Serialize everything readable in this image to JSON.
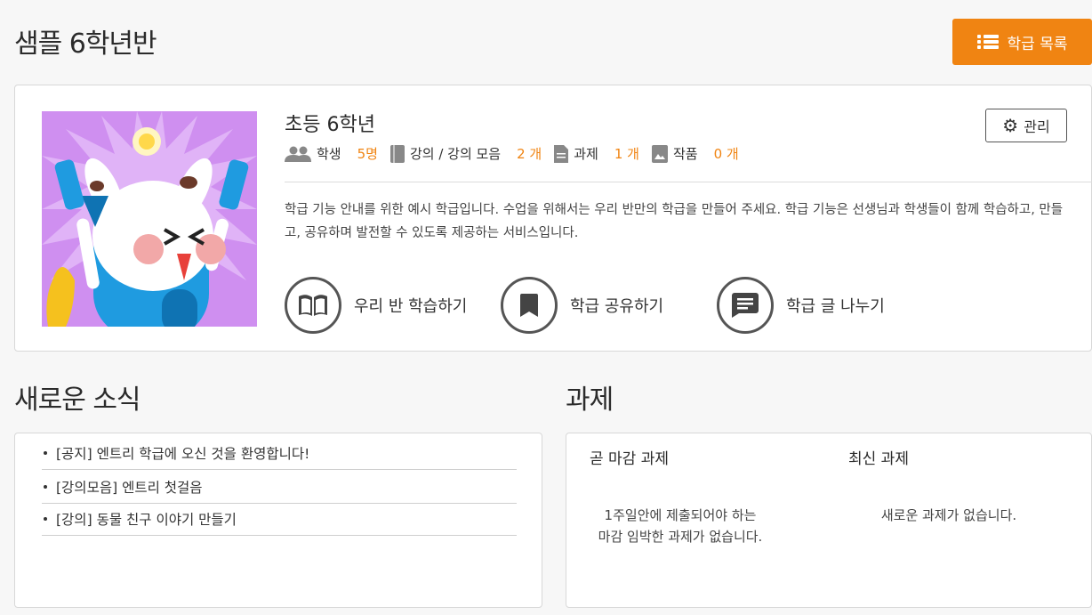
{
  "page": {
    "title": "샘플 6학년반"
  },
  "header": {
    "list_button_label": "학급 목록"
  },
  "class_card": {
    "name": "초등 6학년",
    "manage_label": "관리",
    "stats": [
      {
        "icon": "people-icon",
        "label": "학생",
        "count": "5명"
      },
      {
        "icon": "book-icon",
        "label": "강의 / 강의 모음",
        "count": "2 개"
      },
      {
        "icon": "document-icon",
        "label": "과제",
        "count": "1 개"
      },
      {
        "icon": "image-icon",
        "label": "작품",
        "count": "0 개"
      }
    ],
    "description": "학급 기능 안내를 위한 예시 학급입니다. 수업을 위해서는 우리 반만의 학급을 만들어 주세요. 학급 기능은 선생님과 학생들이 함께 학습하고, 만들고, 공유하며 발전할 수 있도록 제공하는 서비스입니다.",
    "actions": [
      {
        "icon": "open-book-icon",
        "label": "우리 반 학습하기"
      },
      {
        "icon": "bookmark-icon",
        "label": "학급 공유하기"
      },
      {
        "icon": "chat-icon",
        "label": "학급 글 나누기"
      }
    ]
  },
  "news": {
    "title": "새로운 소식",
    "items": [
      {
        "tag": "[공지]",
        "text": "엔트리 학급에 오신 것을 환영합니다!"
      },
      {
        "tag": "[강의모음]",
        "text": "엔트리 첫걸음"
      },
      {
        "tag": "[강의]",
        "text": "동물 친구 이야기 만들기"
      }
    ]
  },
  "tasks": {
    "title": "과제",
    "due_title": "곧 마감 과제",
    "due_empty_line1": "1주일안에 제출되어야 하는",
    "due_empty_line2": "마감 임박한 과제가 없습니다.",
    "recent_title": "최신 과제",
    "recent_empty": "새로운 과제가 없습니다."
  },
  "colors": {
    "accent": "#f08412",
    "thumbnail_bg": "#cf8ff0"
  }
}
